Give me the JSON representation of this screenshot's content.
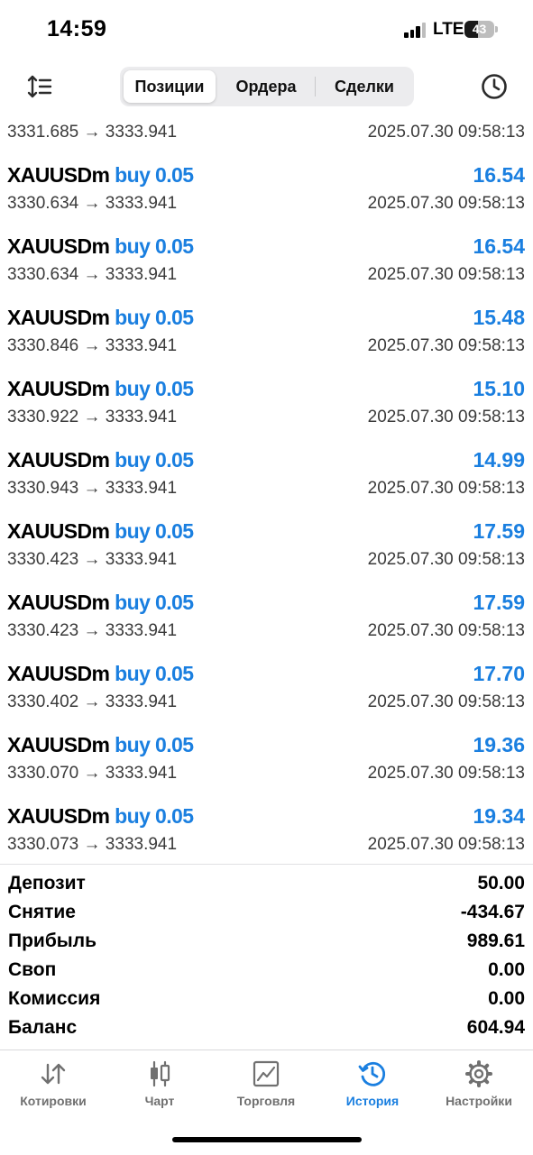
{
  "status_bar": {
    "time": "14:59",
    "network": "LTE",
    "battery": "43"
  },
  "segments": [
    {
      "label": "Позиции",
      "active": true
    },
    {
      "label": "Ордера",
      "active": false
    },
    {
      "label": "Сделки",
      "active": false
    }
  ],
  "partial_deal": {
    "prices": "3331.685 → 3333.941",
    "datetime": "2025.07.30 09:58:13"
  },
  "deals": [
    {
      "symbol": "XAUUSDm",
      "type": "buy 0.05",
      "profit": "16.54",
      "prices": "3330.634 → 3333.941",
      "datetime": "2025.07.30 09:58:13"
    },
    {
      "symbol": "XAUUSDm",
      "type": "buy 0.05",
      "profit": "16.54",
      "prices": "3330.634 → 3333.941",
      "datetime": "2025.07.30 09:58:13"
    },
    {
      "symbol": "XAUUSDm",
      "type": "buy 0.05",
      "profit": "15.48",
      "prices": "3330.846 → 3333.941",
      "datetime": "2025.07.30 09:58:13"
    },
    {
      "symbol": "XAUUSDm",
      "type": "buy 0.05",
      "profit": "15.10",
      "prices": "3330.922 → 3333.941",
      "datetime": "2025.07.30 09:58:13"
    },
    {
      "symbol": "XAUUSDm",
      "type": "buy 0.05",
      "profit": "14.99",
      "prices": "3330.943 → 3333.941",
      "datetime": "2025.07.30 09:58:13"
    },
    {
      "symbol": "XAUUSDm",
      "type": "buy 0.05",
      "profit": "17.59",
      "prices": "3330.423 → 3333.941",
      "datetime": "2025.07.30 09:58:13"
    },
    {
      "symbol": "XAUUSDm",
      "type": "buy 0.05",
      "profit": "17.59",
      "prices": "3330.423 → 3333.941",
      "datetime": "2025.07.30 09:58:13"
    },
    {
      "symbol": "XAUUSDm",
      "type": "buy 0.05",
      "profit": "17.70",
      "prices": "3330.402 → 3333.941",
      "datetime": "2025.07.30 09:58:13"
    },
    {
      "symbol": "XAUUSDm",
      "type": "buy 0.05",
      "profit": "19.36",
      "prices": "3330.070 → 3333.941",
      "datetime": "2025.07.30 09:58:13"
    },
    {
      "symbol": "XAUUSDm",
      "type": "buy 0.05",
      "profit": "19.34",
      "prices": "3330.073 → 3333.941",
      "datetime": "2025.07.30 09:58:13"
    }
  ],
  "summary": [
    {
      "label": "Депозит",
      "value": "50.00"
    },
    {
      "label": "Снятие",
      "value": "-434.67"
    },
    {
      "label": "Прибыль",
      "value": "989.61"
    },
    {
      "label": "Своп",
      "value": "0.00"
    },
    {
      "label": "Комиссия",
      "value": "0.00"
    },
    {
      "label": "Баланс",
      "value": "604.94"
    }
  ],
  "tabs": [
    {
      "label": "Котировки",
      "icon": "quotes-arrows-icon",
      "active": false
    },
    {
      "label": "Чарт",
      "icon": "candlestick-chart-icon",
      "active": false
    },
    {
      "label": "Торговля",
      "icon": "trade-chart-icon",
      "active": false
    },
    {
      "label": "История",
      "icon": "history-clock-icon",
      "active": true
    },
    {
      "label": "Настройки",
      "icon": "gear-icon",
      "active": false
    }
  ],
  "colors": {
    "accent": "#1a7fe0",
    "secondary_text": "#3a3a3a",
    "tab_inactive": "#707070"
  }
}
